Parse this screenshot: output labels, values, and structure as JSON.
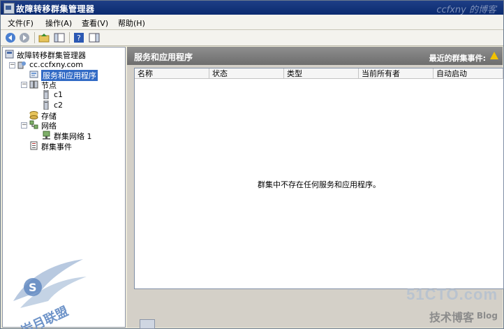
{
  "window": {
    "title": "故障转移群集管理器",
    "watermark": "ccfxny 的博客"
  },
  "menu": [
    "文件(F)",
    "操作(A)",
    "查看(V)",
    "帮助(H)"
  ],
  "toolbar": {
    "icons": [
      "back-icon",
      "forward-icon",
      "up-folder-icon",
      "show-hide-tree-icon",
      "help-icon",
      "action-pane-icon"
    ]
  },
  "tree": {
    "root": "故障转移群集管理器",
    "cluster": "cc.ccfxny.com",
    "services": "服务和应用程序",
    "nodes": "节点",
    "node1": "c1",
    "node2": "c2",
    "storage": "存储",
    "networks": "网络",
    "network1": "群集网络 1",
    "events": "群集事件"
  },
  "content": {
    "heading": "服务和应用程序",
    "recent_events": "最近的群集事件:",
    "columns": [
      "名称",
      "状态",
      "类型",
      "当前所有者",
      "自动启动"
    ],
    "empty_message": "群集中不存在任何服务和应用程序。"
  },
  "watermarks": {
    "logo_text": "岩月联盟",
    "site": "51CTO.com",
    "blog_cn": "技术博客",
    "blog_en": "Blog"
  }
}
